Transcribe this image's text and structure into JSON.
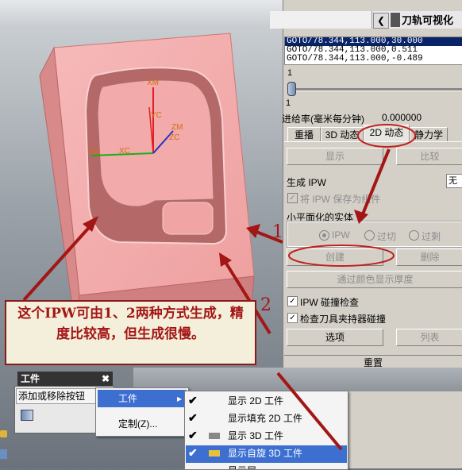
{
  "panel": {
    "title": "刀轨可视化",
    "back_icon": "chevron-left-icon",
    "list_lines": [
      "GOTO/78.344,113.000,30.000",
      "GOTO/78.344,113.000,0.511",
      "GOTO/78.344,113.000,-0.489"
    ],
    "slider_min": "1",
    "slider_value": "1",
    "feed_label": "进给率(毫米每分钟)",
    "feed_value": "0.000000",
    "tabs": [
      "重播",
      "3D 动态",
      "2D 动态",
      "静力学"
    ],
    "active_tab": "2D 动态",
    "display_btn": "显示",
    "compare_btn": "比较",
    "gen_ipw_label": "生成 IPW",
    "gen_ipw_value": "无",
    "save_ipw_label": "将 IPW 保存为组件",
    "facet_label": "小平面化的实体",
    "radio_ipw": "IPW",
    "radio_overcut": "过切",
    "radio_undercut": "过剩",
    "create_btn": "创建",
    "delete_btn": "删除",
    "color_btn": "通过颜色显示厚度",
    "ipw_collision": "IPW 碰撞检查",
    "holder_collision": "检查刀具夹持器碰撞",
    "options_btn": "选项",
    "list_btn": "列表",
    "reset_btn": "重置"
  },
  "model": {
    "axis_labels": [
      "XM",
      "YC",
      "ZM",
      "ZC",
      "YM",
      "XC"
    ],
    "colors": {
      "block": "#f2a9a9",
      "axis_red": "#e02020",
      "axis_green": "#19b019",
      "axis_blue": "#2030d0",
      "axis_label": "#d07010"
    }
  },
  "annotation": {
    "note": "这个IPW可由1、2两种方式生成，精度比较高，但生成很慢。",
    "num1": "1",
    "num2": "2",
    "color": "#a31616"
  },
  "toolbar": {
    "title": "工件",
    "close_icon": "close-icon",
    "add_remove": "添加或移除按钮",
    "menu_item_workpiece": "工件",
    "menu_item_customize": "定制(Z)...",
    "submenu": [
      "显示 2D 工件",
      "显示填充 2D 工件",
      "显示 3D 工件",
      "显示自旋 3D 工件",
      "显示层..."
    ],
    "submenu_highlight": "显示自旋 3D 工件"
  }
}
